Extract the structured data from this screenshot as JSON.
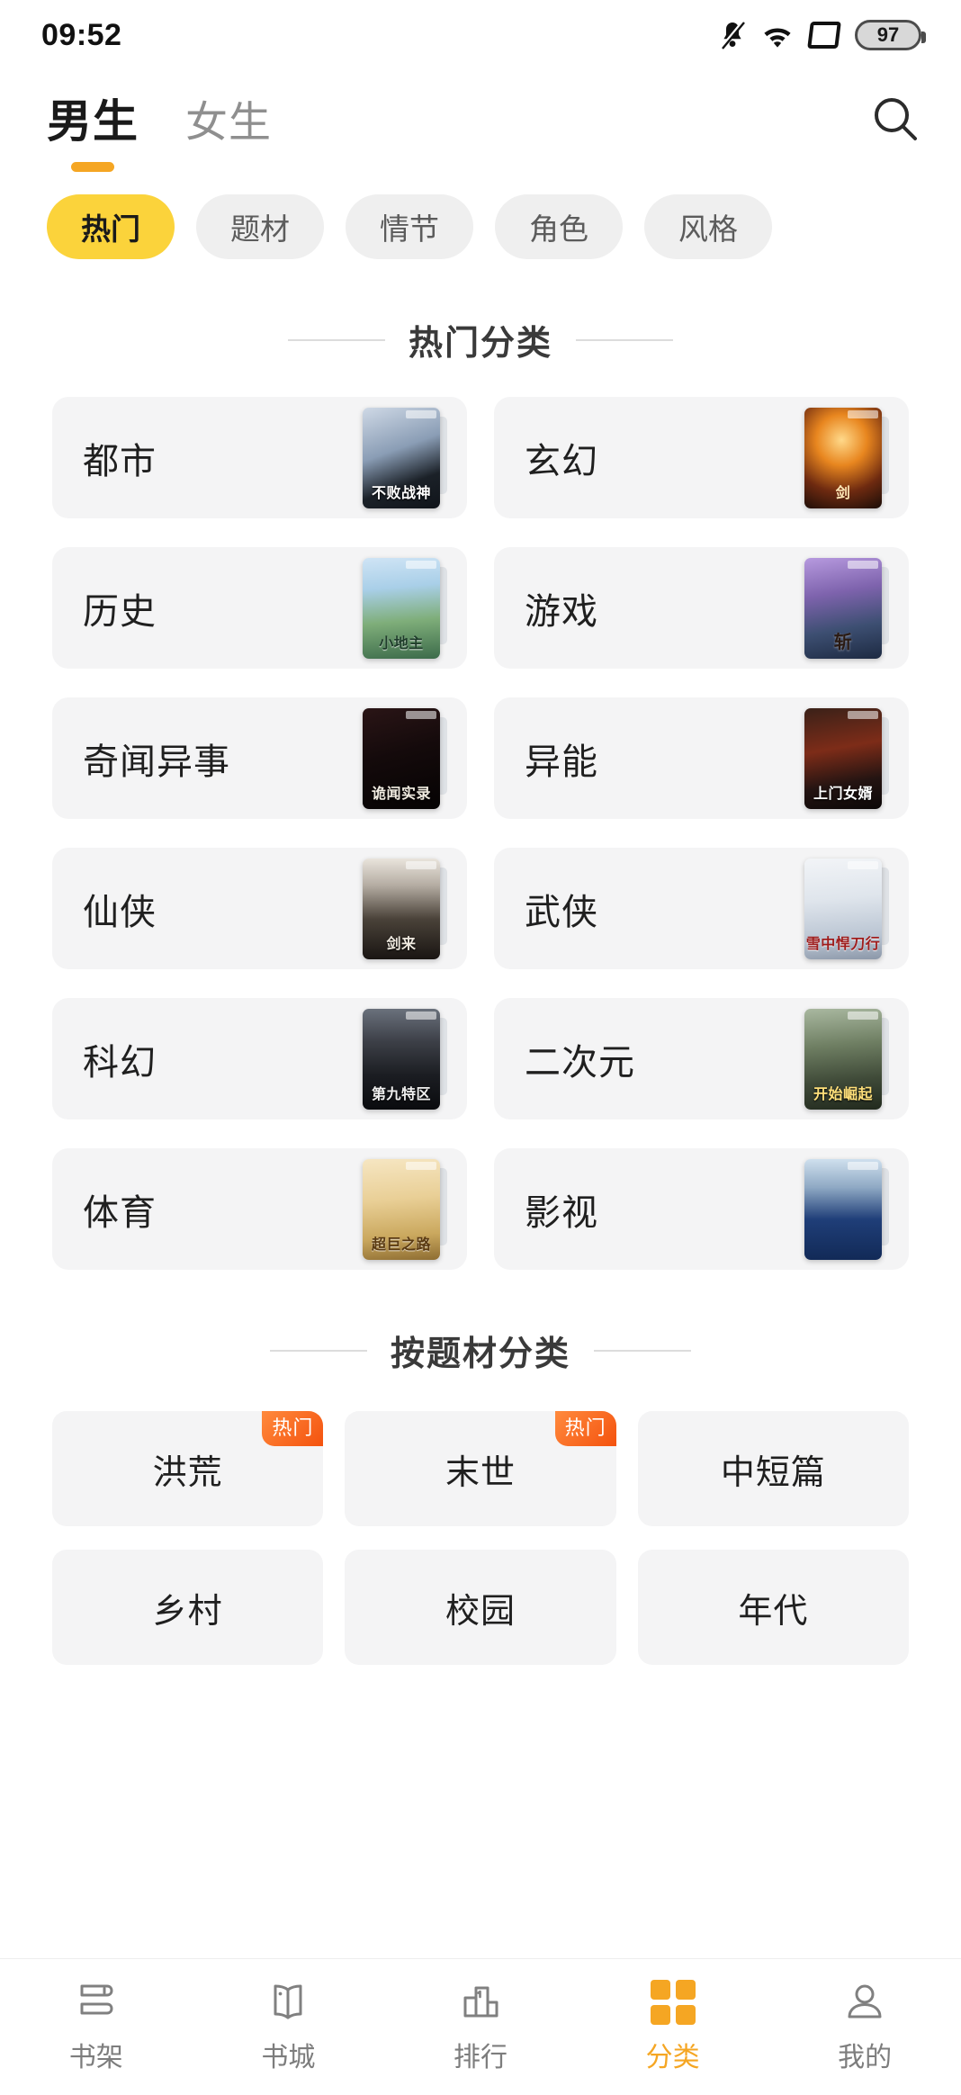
{
  "status_bar": {
    "time": "09:52",
    "battery_level": "97",
    "icons": [
      "bell-muted-icon",
      "wifi-icon",
      "sim-icon",
      "battery-icon"
    ]
  },
  "header": {
    "tabs": [
      {
        "label": "男生",
        "active": true
      },
      {
        "label": "女生",
        "active": false
      }
    ],
    "search_icon": "search-icon"
  },
  "filter_chips": [
    {
      "label": "热门",
      "active": true
    },
    {
      "label": "题材",
      "active": false
    },
    {
      "label": "情节",
      "active": false
    },
    {
      "label": "角色",
      "active": false
    },
    {
      "label": "风格",
      "active": false
    }
  ],
  "hot_section": {
    "title": "热门分类",
    "cards": [
      {
        "name": "都市",
        "cover_title": "不败战神",
        "cover_class": "cv-bzsh"
      },
      {
        "name": "玄幻",
        "cover_title": "剑",
        "cover_class": "cv-xh"
      },
      {
        "name": "历史",
        "cover_title": "小地主",
        "cover_class": "cv-xdz"
      },
      {
        "name": "游戏",
        "cover_title": "斩",
        "cover_class": "cv-zhan"
      },
      {
        "name": "奇闻异事",
        "cover_title": "诡闻实录",
        "cover_class": "cv-gwsl"
      },
      {
        "name": "异能",
        "cover_title": "上门女婿",
        "cover_class": "cv-smnx"
      },
      {
        "name": "仙侠",
        "cover_title": "剑来",
        "cover_class": "cv-jl"
      },
      {
        "name": "武侠",
        "cover_title": "雪中悍刀行",
        "cover_class": "cv-xzdx"
      },
      {
        "name": "科幻",
        "cover_title": "第九特区",
        "cover_class": "cv-djtq"
      },
      {
        "name": "二次元",
        "cover_title": "开始崛起",
        "cover_class": "cv-ksjq"
      },
      {
        "name": "体育",
        "cover_title": "超巨之路",
        "cover_class": "cv-ltcj"
      },
      {
        "name": "影视",
        "cover_title": "",
        "cover_class": "cv-ys"
      }
    ]
  },
  "theme_section": {
    "title": "按题材分类",
    "hot_badge_label": "热门",
    "tags": [
      {
        "label": "洪荒",
        "hot": true
      },
      {
        "label": "末世",
        "hot": true
      },
      {
        "label": "中短篇",
        "hot": false
      },
      {
        "label": "乡村",
        "hot": false
      },
      {
        "label": "校园",
        "hot": false
      },
      {
        "label": "年代",
        "hot": false
      }
    ]
  },
  "bottom_nav": {
    "items": [
      {
        "label": "书架",
        "icon": "bookshelf-icon",
        "active": false
      },
      {
        "label": "书城",
        "icon": "open-book-icon",
        "active": false
      },
      {
        "label": "排行",
        "icon": "ranking-chart-icon",
        "active": false
      },
      {
        "label": "分类",
        "icon": "grid-icon",
        "active": true
      },
      {
        "label": "我的",
        "icon": "person-icon",
        "active": false
      }
    ]
  },
  "colors": {
    "accent_yellow": "#F5A623",
    "chip_active": "#FBD33B",
    "card_bg": "#F4F4F5",
    "hot_badge": "#F4520E",
    "muted_text": "#7d7d7d"
  }
}
